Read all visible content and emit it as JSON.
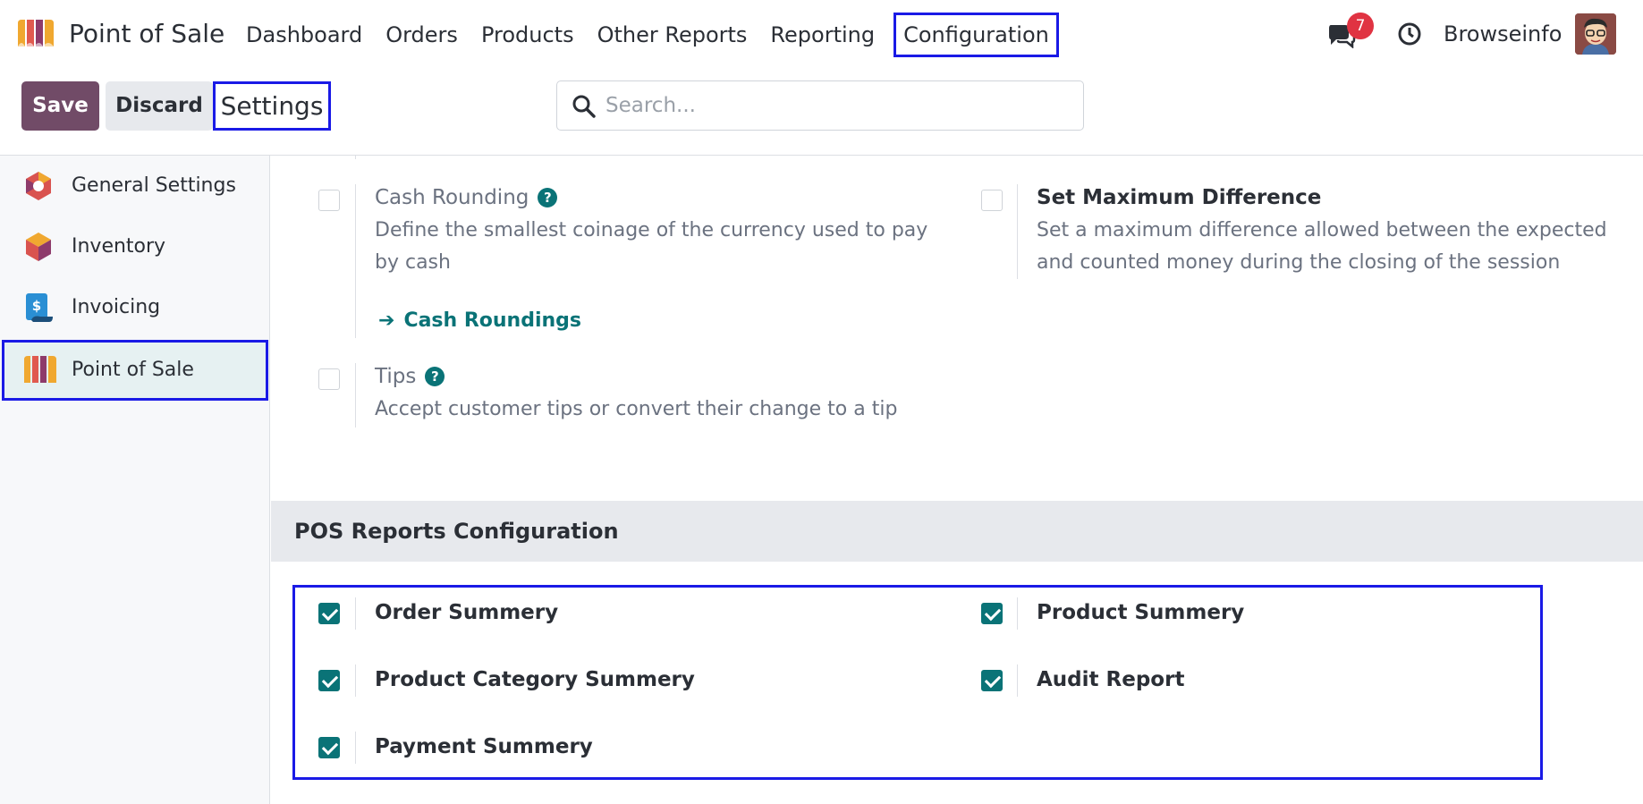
{
  "app": {
    "title": "Point of Sale"
  },
  "nav": {
    "items": [
      "Dashboard",
      "Orders",
      "Products",
      "Other Reports",
      "Reporting",
      "Configuration"
    ]
  },
  "systray": {
    "chat_count": "7",
    "user_name": "Browseinfo"
  },
  "controls": {
    "save_label": "Save",
    "discard_label": "Discard",
    "breadcrumb": "Settings"
  },
  "search": {
    "placeholder": "Search...",
    "value": ""
  },
  "sidebar": {
    "items": [
      {
        "label": "General Settings",
        "icon": "general-settings-icon"
      },
      {
        "label": "Inventory",
        "icon": "inventory-icon"
      },
      {
        "label": "Invoicing",
        "icon": "invoicing-icon"
      },
      {
        "label": "Point of Sale",
        "icon": "point-of-sale-icon",
        "active": true
      }
    ]
  },
  "settings": {
    "cash_rounding": {
      "title": "Cash Rounding",
      "description": "Define the smallest coinage of the currency used to pay by cash",
      "link": "Cash Roundings",
      "checked": false
    },
    "max_difference": {
      "title": "Set Maximum Difference",
      "description": "Set a maximum difference allowed between the expected and counted money during the closing of the session",
      "checked": false
    },
    "tips": {
      "title": "Tips",
      "description": "Accept customer tips or convert their change to a tip",
      "checked": false
    }
  },
  "reports_section": {
    "title": "POS Reports Configuration",
    "items": [
      {
        "label": "Order Summery",
        "checked": true
      },
      {
        "label": "Product Summery",
        "checked": true
      },
      {
        "label": "Product Category Summery",
        "checked": true
      },
      {
        "label": "Audit Report",
        "checked": true
      },
      {
        "label": "Payment Summery",
        "checked": true
      }
    ]
  },
  "colors": {
    "brand": "#714b67",
    "accent": "#0a7377",
    "highlight": "#1a1ae6",
    "badge": "#e03342"
  }
}
